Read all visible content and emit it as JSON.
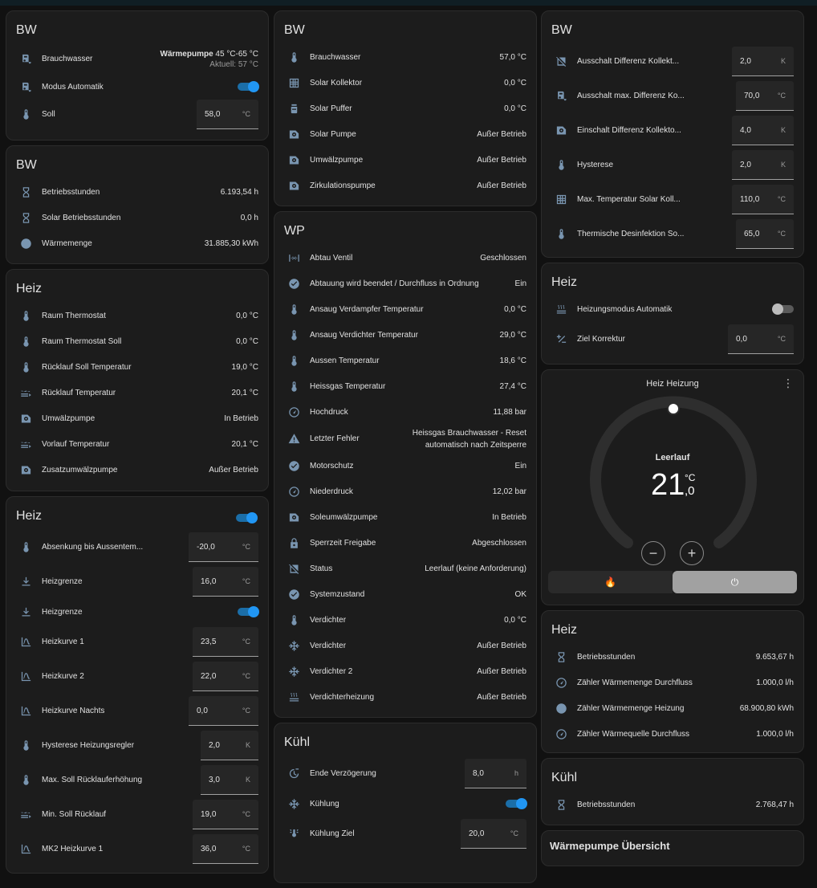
{
  "col1": {
    "bw1": {
      "title": "BW",
      "brauchwasser_label": "Brauchwasser",
      "brauchwasser_bold": "Wärmepumpe",
      "brauchwasser_range": " 45 °C-65 °C",
      "brauchwasser_sub": "Aktuell: 57 °C",
      "modus_label": "Modus Automatik",
      "soll_label": "Soll",
      "soll_value": "58,0",
      "soll_unit": "°C"
    },
    "bw2": {
      "title": "BW",
      "rows": [
        {
          "label": "Betriebsstunden",
          "value": "6.193,54 h"
        },
        {
          "label": "Solar Betriebsstunden",
          "value": "0,0 h"
        },
        {
          "label": "Wärmemenge",
          "value": "31.885,30 kWh"
        }
      ]
    },
    "heiz1": {
      "title": "Heiz",
      "rows": [
        {
          "label": "Raum Thermostat",
          "value": "0,0 °C"
        },
        {
          "label": "Raum Thermostat Soll",
          "value": "0,0 °C"
        },
        {
          "label": "Rücklauf Soll Temperatur",
          "value": "19,0 °C"
        },
        {
          "label": "Rücklauf Temperatur",
          "value": "20,1 °C"
        },
        {
          "label": "Umwälzpumpe",
          "value": "In Betrieb"
        },
        {
          "label": "Vorlauf Temperatur",
          "value": "20,1 °C"
        },
        {
          "label": "Zusatzumwälzpumpe",
          "value": "Außer Betrieb"
        }
      ]
    },
    "heiz2": {
      "title": "Heiz",
      "absenkung_label": "Absenkung bis Aussentem...",
      "absenkung_value": "-20,0",
      "absenkung_unit": "°C",
      "heizgrenze_label": "Heizgrenze",
      "heizgrenze_value": "16,0",
      "heizgrenze_unit": "°C",
      "heizgrenze2_label": "Heizgrenze",
      "kurve1_label": "Heizkurve 1",
      "kurve1_value": "23,5",
      "kurve1_unit": "°C",
      "kurve2_label": "Heizkurve 2",
      "kurve2_value": "22,0",
      "kurve2_unit": "°C",
      "nachts_label": "Heizkurve Nachts",
      "nachts_value": "0,0",
      "nachts_unit": "°C",
      "hyst_label": "Hysterese Heizungsregler",
      "hyst_value": "2,0",
      "hyst_unit": "K",
      "maxsoll_label": "Max. Soll Rücklauferhöhung",
      "maxsoll_value": "3,0",
      "maxsoll_unit": "K",
      "minsoll_label": "Min. Soll Rücklauf",
      "minsoll_value": "19,0",
      "minsoll_unit": "°C",
      "mk2_label": "MK2 Heizkurve 1",
      "mk2_value": "36,0",
      "mk2_unit": "°C"
    }
  },
  "col2": {
    "bw": {
      "title": "BW",
      "rows": [
        {
          "label": "Brauchwasser",
          "value": "57,0 °C"
        },
        {
          "label": "Solar Kollektor",
          "value": "0,0 °C"
        },
        {
          "label": "Solar Puffer",
          "value": "0,0 °C"
        },
        {
          "label": "Solar Pumpe",
          "value": "Außer Betrieb"
        },
        {
          "label": "Umwälzpumpe",
          "value": "Außer Betrieb"
        },
        {
          "label": "Zirkulationspumpe",
          "value": "Außer Betrieb"
        }
      ]
    },
    "wp": {
      "title": "WP",
      "rows": [
        {
          "label": "Abtau Ventil",
          "value": "Geschlossen"
        },
        {
          "label": "Abtauung wird beendet / Durchfluss in Ordnung",
          "value": "Ein"
        },
        {
          "label": "Ansaug Verdampfer Temperatur",
          "value": "0,0 °C"
        },
        {
          "label": "Ansaug Verdichter Temperatur",
          "value": "29,0 °C"
        },
        {
          "label": "Aussen Temperatur",
          "value": "18,6 °C"
        },
        {
          "label": "Heissgas Temperatur",
          "value": "27,4 °C"
        },
        {
          "label": "Hochdruck",
          "value": "11,88 bar"
        }
      ],
      "fehler_label": "Letzter Fehler",
      "fehler_value": "Heissgas Brauchwasser - Reset automatisch nach Zeitsperre",
      "rows2": [
        {
          "label": "Motorschutz",
          "value": "Ein"
        },
        {
          "label": "Niederdruck",
          "value": "12,02 bar"
        },
        {
          "label": "Soleumwälzpumpe",
          "value": "In Betrieb"
        },
        {
          "label": "Sperrzeit Freigabe",
          "value": "Abgeschlossen"
        },
        {
          "label": "Status",
          "value": "Leerlauf (keine Anforderung)"
        },
        {
          "label": "Systemzustand",
          "value": "OK"
        },
        {
          "label": "Verdichter",
          "value": "0,0 °C"
        },
        {
          "label": "Verdichter",
          "value": "Außer Betrieb"
        },
        {
          "label": "Verdichter 2",
          "value": "Außer Betrieb"
        },
        {
          "label": "Verdichterheizung",
          "value": "Außer Betrieb"
        }
      ]
    },
    "kuehl": {
      "title": "Kühl",
      "ende_label": "Ende Verzögerung",
      "ende_value": "8,0",
      "ende_unit": "h",
      "kuehlung_label": "Kühlung",
      "ziel_label": "Kühlung Ziel",
      "ziel_value": "20,0",
      "ziel_unit": "°C"
    }
  },
  "col3": {
    "bw": {
      "title": "BW",
      "r1_label": "Ausschalt Differenz Kollekt...",
      "r1_value": "2,0",
      "r1_unit": "K",
      "r2_label": "Ausschalt max. Differenz Ko...",
      "r2_value": "70,0",
      "r2_unit": "°C",
      "r3_label": "Einschalt Differenz Kollekto...",
      "r3_value": "4,0",
      "r3_unit": "K",
      "r4_label": "Hysterese",
      "r4_value": "2,0",
      "r4_unit": "K",
      "r5_label": "Max. Temperatur Solar Koll...",
      "r5_value": "110,0",
      "r5_unit": "°C",
      "r6_label": "Thermische Desinfektion So...",
      "r6_value": "65,0",
      "r6_unit": "°C"
    },
    "heiz1": {
      "title": "Heiz",
      "modus_label": "Heizungsmodus Automatik",
      "ziel_label": "Ziel Korrektur",
      "ziel_value": "0,0",
      "ziel_unit": "°C"
    },
    "thermo": {
      "title": "Heiz Heizung",
      "menu": "⋮",
      "state": "Leerlauf",
      "temp_int": "21",
      "temp_unit": "°C",
      "temp_dec": ",0",
      "minus": "−",
      "plus": "+",
      "mode_heat": "🔥",
      "mode_off": "⏻"
    },
    "heiz2": {
      "title": "Heiz",
      "rows": [
        {
          "label": "Betriebsstunden",
          "value": "9.653,67 h"
        },
        {
          "label": "Zähler Wärmemenge Durchfluss",
          "value": "1.000,0 l/h"
        },
        {
          "label": "Zähler Wärmemenge Heizung",
          "value": "68.900,80 kWh"
        },
        {
          "label": "Zähler Wärmequelle Durchfluss",
          "value": "1.000,0 l/h"
        }
      ]
    },
    "kuehl": {
      "title": "Kühl",
      "rows": [
        {
          "label": "Betriebsstunden",
          "value": "2.768,47 h"
        }
      ]
    },
    "wp_title": "Wärmepumpe Übersicht"
  },
  "icons": {
    "thermometer": "thermometer-icon",
    "hourglass": "hourglass-icon",
    "pump": "pump-icon",
    "flash": "flash-icon",
    "check": "check-circle-icon",
    "water_boiler": "water-boiler-icon"
  }
}
